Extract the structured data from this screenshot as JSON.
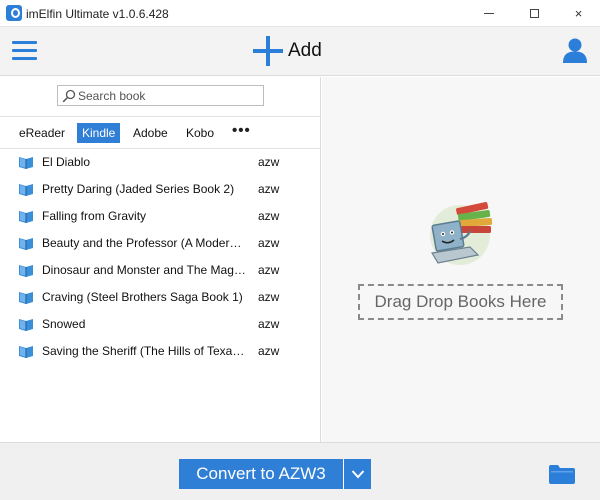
{
  "window": {
    "title": "imElfin Ultimate v1.0.6.428",
    "controls": {
      "minimize": "minimize-icon",
      "maximize": "maximize-icon",
      "close": "×"
    }
  },
  "toolbar": {
    "menu_icon": "hamburger-icon",
    "add_label": "Add",
    "add_icon": "plus-icon",
    "user_icon": "user-icon"
  },
  "search": {
    "placeholder": "Search book",
    "value": ""
  },
  "tabs": [
    {
      "label": "eReader",
      "active": false
    },
    {
      "label": "Kindle",
      "active": true
    },
    {
      "label": "Adobe",
      "active": false
    },
    {
      "label": "Kobo",
      "active": false
    }
  ],
  "more_label": "•••",
  "books": [
    {
      "title": "El Diablo",
      "format": "azw"
    },
    {
      "title": "Pretty Daring (Jaded Series Book 2)",
      "format": "azw"
    },
    {
      "title": "Falling from Gravity",
      "format": "azw"
    },
    {
      "title": "Beauty and the Professor (A Modern F...",
      "format": "azw"
    },
    {
      "title": "Dinosaur and Monster and The Magic ...",
      "format": "azw"
    },
    {
      "title": "Craving (Steel Brothers Saga Book 1)",
      "format": "azw"
    },
    {
      "title": "Snowed",
      "format": "azw"
    },
    {
      "title": "Saving the Sheriff (The Hills of Texas B...",
      "format": "azw"
    }
  ],
  "drop_zone": {
    "label": "Drag Drop Books Here",
    "illustration": "laptop-books-icon"
  },
  "bottom": {
    "convert_label": "Convert to AZW3",
    "dropdown_icon": "chevron-down-icon",
    "folder_icon": "folder-icon"
  },
  "colors": {
    "accent": "#2f7fd6",
    "toolbar_bg": "#f3f3f3",
    "drop_bg": "#f7f7f7"
  }
}
